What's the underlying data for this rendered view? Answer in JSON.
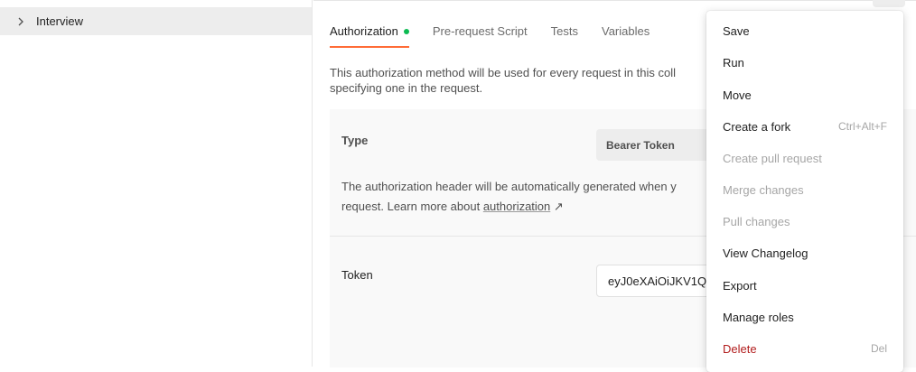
{
  "sidebar": {
    "items": [
      {
        "label": "Interview"
      }
    ]
  },
  "tabs": [
    {
      "label": "Authorization",
      "active": true
    },
    {
      "label": "Pre-request Script"
    },
    {
      "label": "Tests"
    },
    {
      "label": "Variables"
    }
  ],
  "description": {
    "line1": "This authorization method will be used for every request in this coll",
    "line2": "specifying one in the request."
  },
  "auth": {
    "type_label": "Type",
    "type_value": "Bearer Token",
    "note_line1": "The authorization header will be automatically generated when y",
    "note_line2_prefix": "request. Learn more about ",
    "note_link": "authorization",
    "note_link_arrow": "↗",
    "token_label": "Token",
    "token_value": "eyJ0eXAiOiJKV1Q"
  },
  "menu": {
    "items": [
      {
        "label": "Save",
        "shortcut": ""
      },
      {
        "label": "Run",
        "shortcut": ""
      },
      {
        "label": "Move",
        "shortcut": ""
      },
      {
        "label": "Create a fork",
        "shortcut": "Ctrl+Alt+F"
      },
      {
        "label": "Create pull request",
        "shortcut": "",
        "disabled": true
      },
      {
        "label": "Merge changes",
        "shortcut": "",
        "disabled": true
      },
      {
        "label": "Pull changes",
        "shortcut": "",
        "disabled": true
      },
      {
        "label": "View Changelog",
        "shortcut": ""
      },
      {
        "label": "Export",
        "shortcut": ""
      },
      {
        "label": "Manage roles",
        "shortcut": ""
      },
      {
        "label": "Delete",
        "shortcut": "Del",
        "danger": true
      }
    ]
  },
  "colors": {
    "accent": "#ff6c37",
    "status_dot": "#0cbb52",
    "danger": "#b21d1d"
  },
  "icons": {
    "tree_chevron": "chevron-right-icon",
    "link_arrow": "external-link-arrow-icon",
    "status": "status-dot-icon"
  }
}
